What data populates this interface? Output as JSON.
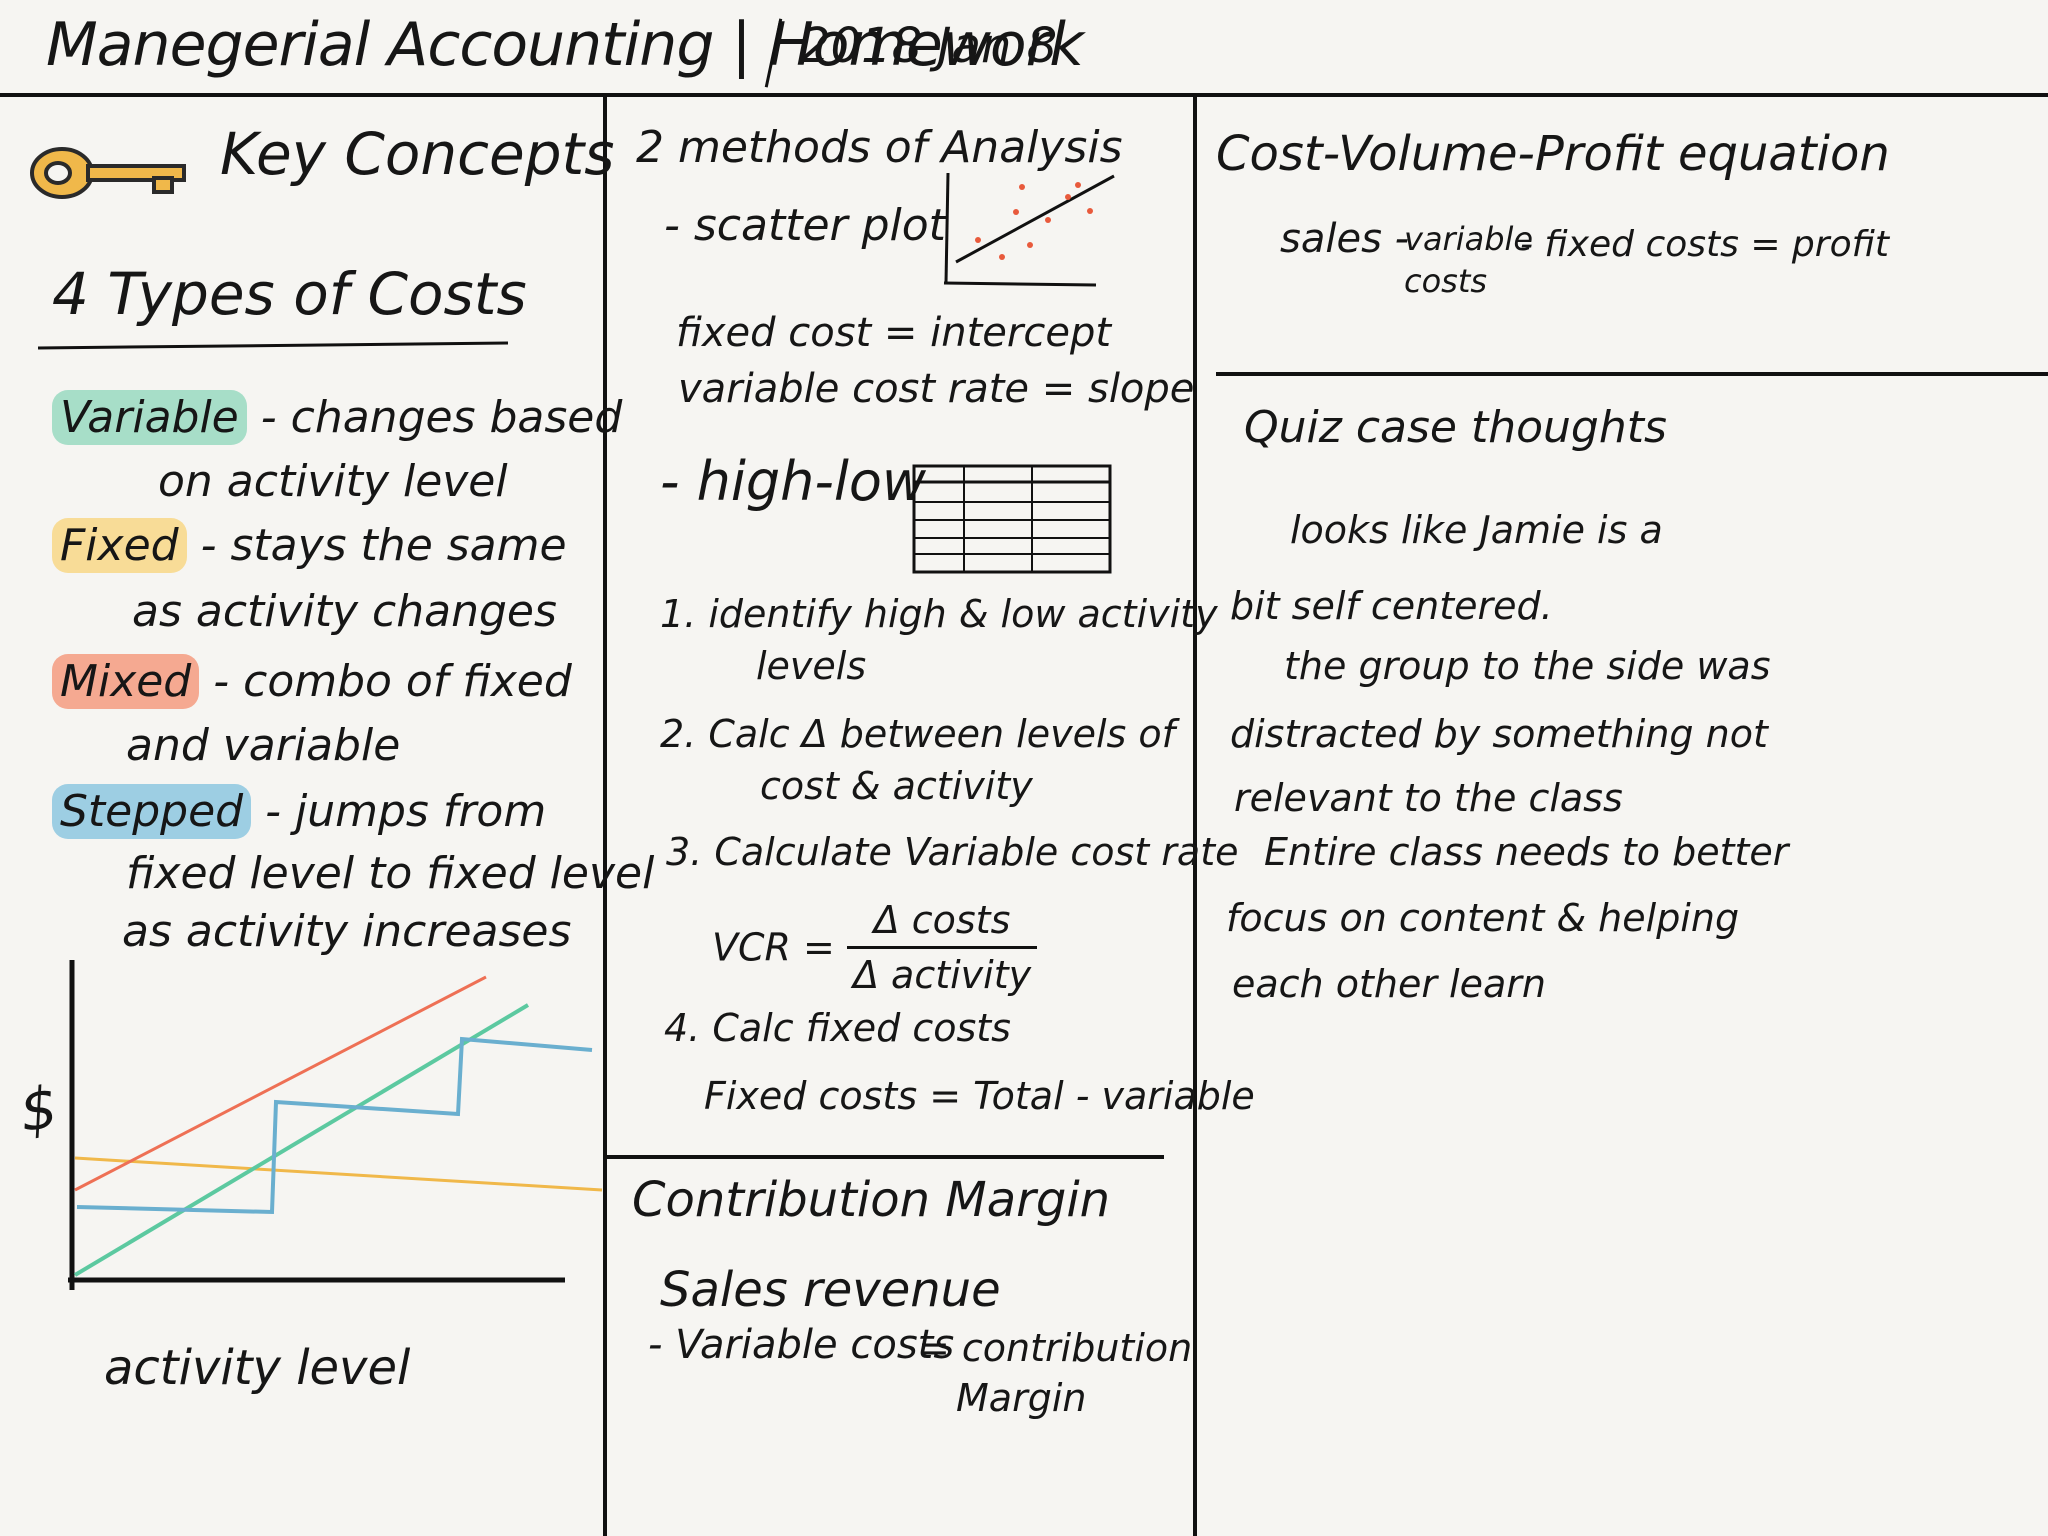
{
  "header": {
    "course": "Manegerial Accounting",
    "section": "Homework",
    "date": "2018 Jan 8"
  },
  "colors": {
    "ink": "#161616",
    "variable": "#8cd6ba",
    "fixed": "#f9d680",
    "mixed": "#f59678",
    "stepped": "#87c4de",
    "key": "#f0b84a",
    "scatter_points": "#e85a3c"
  },
  "key_concepts": {
    "icon": "key-icon",
    "heading": "Key Concepts",
    "types_heading": "4 Types of Costs",
    "types": [
      {
        "name": "Variable",
        "dash": "-",
        "line1": "changes based",
        "line2": "on activity level"
      },
      {
        "name": "Fixed",
        "dash": "-",
        "line1": "stays the same",
        "line2": "as activity changes"
      },
      {
        "name": "Mixed",
        "dash": "-",
        "line1": "combo of fixed",
        "line2": "and variable"
      },
      {
        "name": "Stepped",
        "dash": "-",
        "line1": "jumps from",
        "line2": "fixed level to fixed level",
        "line3": "as activity increases"
      }
    ],
    "graph": {
      "y_label": "$",
      "x_label": "activity level"
    }
  },
  "analysis": {
    "heading": "2 methods of Analysis",
    "scatter_label": "- scatter plot",
    "fixed_cost_line": "fixed cost = intercept",
    "variable_rate_line": "variable cost rate = slope",
    "highlow_label": "- high-low",
    "steps": [
      {
        "num": "1.",
        "text": "identify high & low activity",
        "text2": "levels"
      },
      {
        "num": "2.",
        "text": "Calc Δ between levels of",
        "text2": "cost & activity"
      },
      {
        "num": "3.",
        "text": "Calculate Variable cost rate"
      },
      {
        "num": "4.",
        "text": "Calc fixed costs"
      }
    ],
    "vcr": {
      "lhs": "VCR =",
      "numerator": "Δ costs",
      "denominator": "Δ activity"
    },
    "fixed_formula": "Fixed costs = Total - variable"
  },
  "contribution": {
    "heading": "Contribution Margin",
    "line1": "Sales revenue",
    "line2": "- Variable costs",
    "equals": "= contribution",
    "result2": "Margin"
  },
  "cvp": {
    "heading": "Cost-Volume-Profit equation",
    "sales": "sales -",
    "variable": "variable",
    "costs": "costs",
    "rest": "- fixed costs = profit"
  },
  "quiz": {
    "heading": "Quiz case thoughts",
    "lines": [
      "looks like Jamie is a",
      "bit self centered.",
      "the group to the side was",
      "distracted by something not",
      "relevant to the class",
      "Entire class needs to better",
      "focus on content & helping",
      "each other learn"
    ]
  }
}
